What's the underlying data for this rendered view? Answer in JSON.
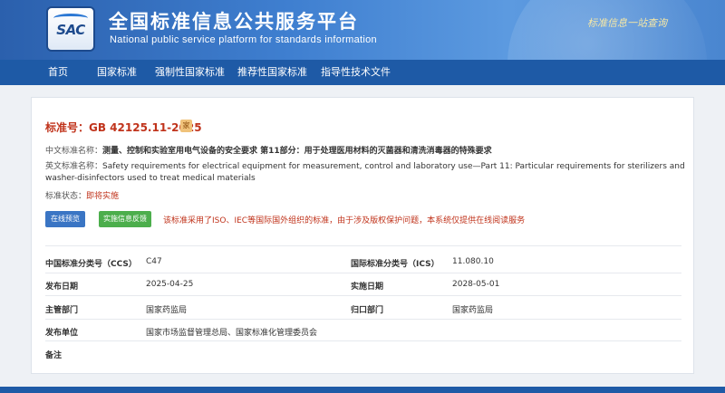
{
  "header": {
    "logo_text": "SAC",
    "title": "全国标准信息公共服务平台",
    "subtitle": "National public service platform  for standards information",
    "slogan": "标准信息一站查询"
  },
  "nav": {
    "items": [
      {
        "label": "首页"
      },
      {
        "label": "国家标准"
      },
      {
        "label": "强制性国家标准"
      },
      {
        "label": "推荐性国家标准"
      },
      {
        "label": "指导性技术文件"
      }
    ]
  },
  "standard": {
    "number_label": "标准号：GB 42125.11-2025",
    "tag": "家",
    "cn_name_label": "中文标准名称：",
    "cn_name": "测量、控制和实验室用电气设备的安全要求 第11部分：用于处理医用材料的灭菌器和清洗消毒器的特殊要求",
    "en_name_label": "英文标准名称：",
    "en_name_line1": "Safety requirements for electrical equipment for measurement, control and laboratory use—Part 11: Particular requirements for sterilizers and",
    "en_name_line2": "washer-disinfectors used to treat medical materials",
    "status_label": "标准状态：",
    "status": "即将实施"
  },
  "actions": {
    "preview_label": "在线预览",
    "feedback_label": "实施信息反馈",
    "notice": "该标准采用了ISO、IEC等国际国外组织的标准，由于涉及版权保护问题，本系统仅提供在线阅读服务"
  },
  "details": {
    "ccs_label": "中国标准分类号（CCS）",
    "ccs": "C47",
    "ics_label": "国际标准分类号（ICS）",
    "ics": "11.080.10",
    "publish_date_label": "发布日期",
    "publish_date": "2025-04-25",
    "implement_date_label": "实施日期",
    "implement_date": "2028-05-01",
    "authority_label": "主管部门",
    "authority": "国家药监局",
    "owner_label": "归口部门",
    "owner": "国家药监局",
    "publisher_label": "发布单位",
    "publisher": "国家市场监督管理总局、国家标准化管理委员会",
    "remark_label": "备注",
    "remark": ""
  }
}
